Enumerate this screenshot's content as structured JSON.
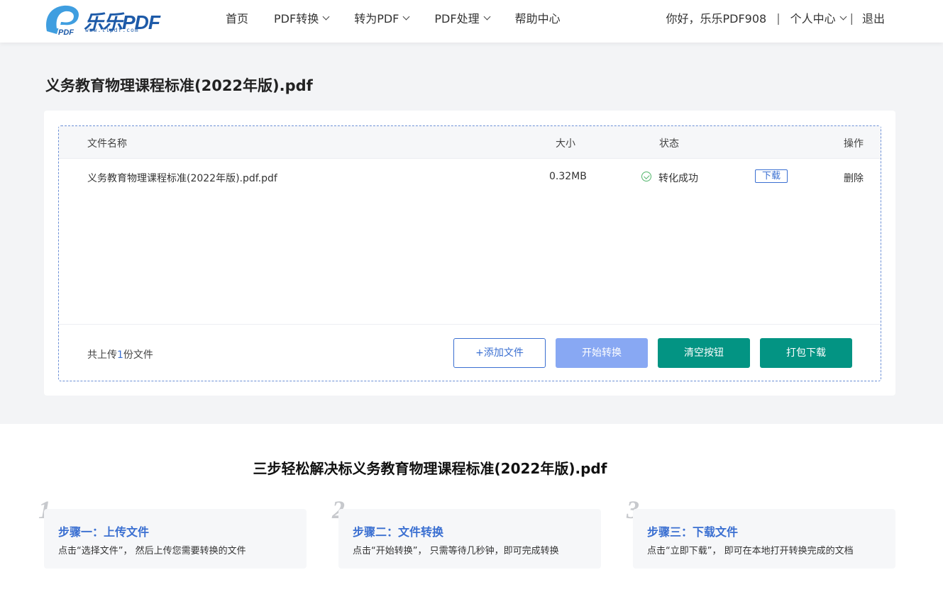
{
  "header": {
    "logo_text": "乐乐PDF",
    "logo_url": "www.llpdf.com",
    "nav": [
      {
        "label": "首页",
        "dropdown": false
      },
      {
        "label": "PDF转换",
        "dropdown": true
      },
      {
        "label": "转为PDF",
        "dropdown": true
      },
      {
        "label": "PDF处理",
        "dropdown": true
      },
      {
        "label": "帮助中心",
        "dropdown": false
      }
    ],
    "greeting": "你好，乐乐PDF908",
    "separator": "|",
    "user_center": "个人中心",
    "logout": "退出"
  },
  "page_title": "义务教育物理课程标准(2022年版).pdf",
  "table": {
    "headers": {
      "name": "文件名称",
      "size": "大小",
      "status": "状态",
      "action": "操作"
    },
    "rows": [
      {
        "name": "义务教育物理课程标准(2022年版).pdf.pdf",
        "size": "0.32MB",
        "status": "转化成功",
        "download": "下载",
        "delete": "删除"
      }
    ]
  },
  "footer": {
    "count_prefix": "共上传",
    "count": "1",
    "count_suffix": "份文件",
    "add_label": "+添加文件",
    "start_label": "开始转换",
    "clear_label": "清空按钮",
    "pack_label": "打包下载"
  },
  "steps": {
    "title": "三步轻松解决标义务教育物理课程标准(2022年版).pdf",
    "items": [
      {
        "num": "1",
        "title": "步骤一：上传文件",
        "desc": "点击“选择文件”， 然后上传您需要转换的文件"
      },
      {
        "num": "2",
        "title": "步骤二：文件转换",
        "desc": "点击“开始转换”， 只需等待几秒钟，即可完成转换"
      },
      {
        "num": "3",
        "title": "步骤三：下载文件",
        "desc": "点击“立即下载”， 即可在本地打开转换完成的文档"
      }
    ]
  },
  "colors": {
    "accent": "#3a6fd1",
    "teal": "#039483",
    "disabled_blue": "#88a8f3",
    "success": "#52b56b"
  }
}
